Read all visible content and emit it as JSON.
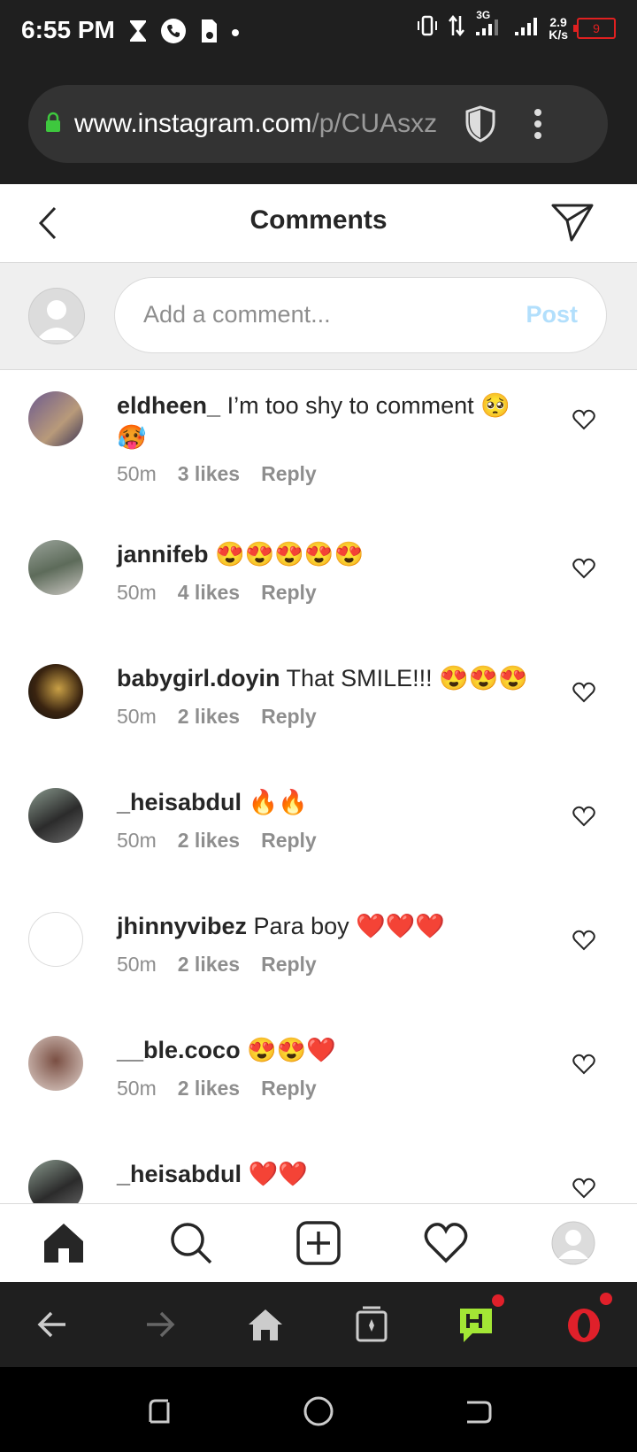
{
  "status_bar": {
    "time": "6:55 PM",
    "network_type": "3G",
    "speed_value": "2.9",
    "speed_unit": "K/s",
    "battery": "9"
  },
  "browser": {
    "url_host": "www.instagram.com",
    "url_path": "/p/CUAsxz"
  },
  "header": {
    "title": "Comments"
  },
  "comment_input": {
    "placeholder": "Add a comment...",
    "post_label": "Post",
    "post_color": "#b2dffc"
  },
  "comments": [
    {
      "user": "eldheen_",
      "text": "I’m too shy to comment 🥺🥵",
      "time": "50m",
      "likes": "3 likes",
      "reply": "Reply"
    },
    {
      "user": "jannifeb",
      "text": "😍😍😍😍😍",
      "time": "50m",
      "likes": "4 likes",
      "reply": "Reply"
    },
    {
      "user": "babygirl.doyin",
      "text": "That SMILE!!! 😍😍😍",
      "time": "50m",
      "likes": "2 likes",
      "reply": "Reply"
    },
    {
      "user": "_heisabdul",
      "text": "🔥🔥",
      "time": "50m",
      "likes": "2 likes",
      "reply": "Reply"
    },
    {
      "user": "jhinnyvibez",
      "text": "Para boy ❤️❤️❤️",
      "time": "50m",
      "likes": "2 likes",
      "reply": "Reply"
    },
    {
      "user": "__ble.coco",
      "text": "😍😍❤️",
      "time": "50m",
      "likes": "2 likes",
      "reply": "Reply"
    },
    {
      "user": "_heisabdul",
      "text": "❤️❤️",
      "time": "",
      "likes": "",
      "reply": ""
    }
  ],
  "bottom_nav": [
    "home-icon",
    "search-icon",
    "new-post-icon",
    "activity-heart-icon",
    "profile-icon"
  ],
  "browser_nav": [
    "back-arrow-icon",
    "forward-arrow-icon",
    "home-icon",
    "tabs-icon",
    "hype-icon",
    "opera-menu-icon"
  ],
  "colors": {
    "accent": "#b2dffc",
    "dark_bar": "#1f1f1f",
    "text": "#262626",
    "secondary": "#8e8e8e",
    "notification": "#e0202a",
    "hype": "#a3e635"
  }
}
